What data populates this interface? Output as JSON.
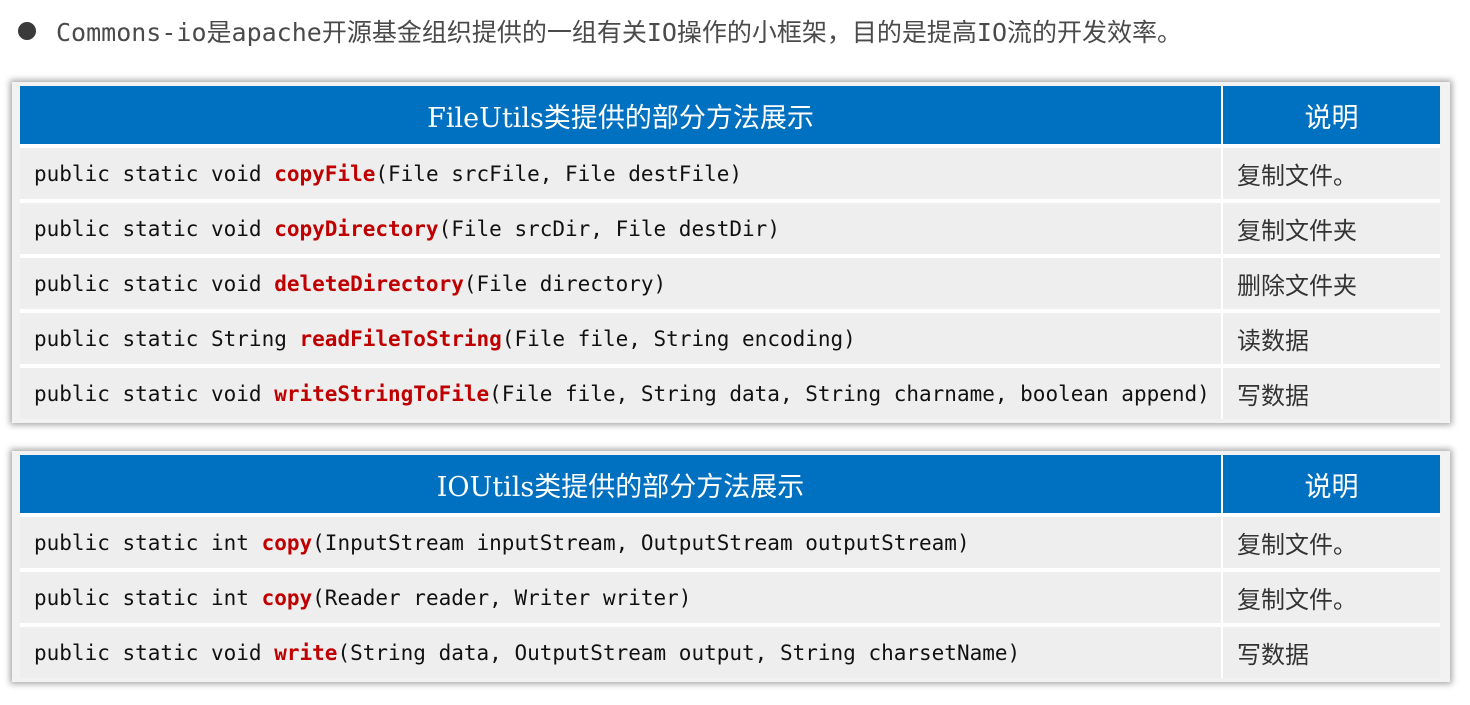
{
  "intro": {
    "text": "Commons-io是apache开源基金组织提供的一组有关IO操作的小框架，目的是提高IO流的开发效率。"
  },
  "file_utils_table": {
    "header_method": "FileUtils类提供的部分方法展示",
    "header_desc": "说明",
    "rows": [
      {
        "prefix": "public static void ",
        "name": "copyFile",
        "params": "(File srcFile, File destFile)",
        "desc": "复制文件。"
      },
      {
        "prefix": "public static void ",
        "name": "copyDirectory",
        "params": "(File srcDir, File destDir)",
        "desc": "复制文件夹"
      },
      {
        "prefix": "public static void ",
        "name": "deleteDirectory",
        "params": "(File directory)",
        "desc": "删除文件夹"
      },
      {
        "prefix": "public static String ",
        "name": "readFileToString",
        "params": "(File file, String encoding)",
        "desc": "读数据"
      },
      {
        "prefix": "public static void ",
        "name": "writeStringToFile",
        "params": "(File file, String data, String charname, boolean append)",
        "desc": "写数据"
      }
    ]
  },
  "io_utils_table": {
    "header_method": "IOUtils类提供的部分方法展示",
    "header_desc": "说明",
    "rows": [
      {
        "prefix": "public static int ",
        "name": "copy",
        "params": "(InputStream inputStream, OutputStream outputStream)",
        "desc": "复制文件。"
      },
      {
        "prefix": "public static int ",
        "name": "copy",
        "params": "(Reader reader, Writer writer)",
        "desc": "复制文件。"
      },
      {
        "prefix": "public static void ",
        "name": "write",
        "params": "(String data, OutputStream output, String charsetName)",
        "desc": "写数据"
      }
    ]
  },
  "colors": {
    "header_bg": "#0070c0",
    "method_name": "#c00000",
    "row_bg": "#eeeeee"
  }
}
